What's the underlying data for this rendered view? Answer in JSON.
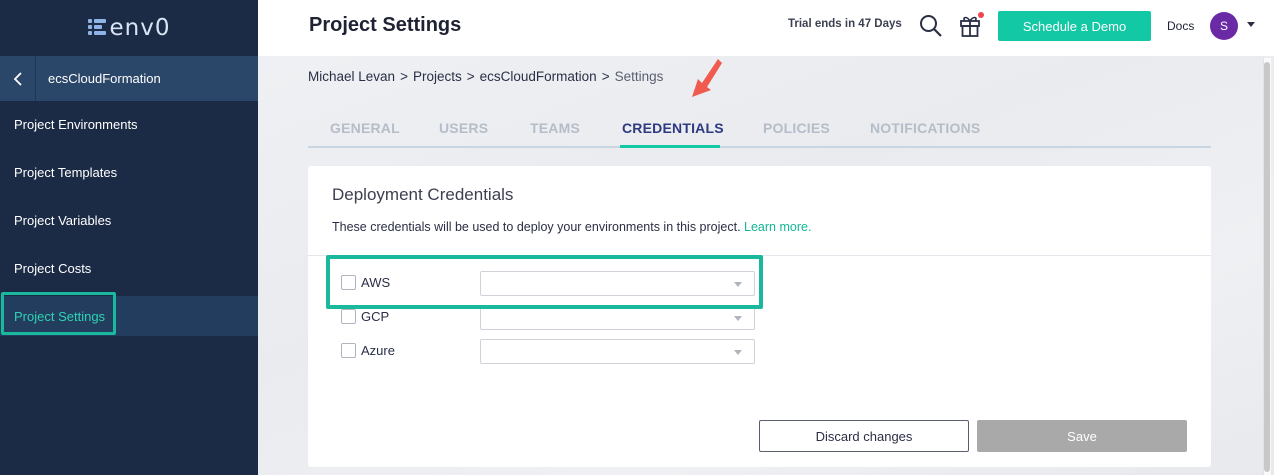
{
  "app": {
    "logo_text": "env0"
  },
  "sidebar": {
    "back_label": "<",
    "project_name": "ecsCloudFormation",
    "items": [
      {
        "label": "Project Environments"
      },
      {
        "label": "Project Templates"
      },
      {
        "label": "Project Variables"
      },
      {
        "label": "Project Costs"
      },
      {
        "label": "Project Settings",
        "active": true
      }
    ]
  },
  "header": {
    "title": "Project Settings",
    "trial_text": "Trial ends in 47 Days",
    "demo_button": "Schedule a Demo",
    "docs_label": "Docs",
    "avatar_initial": "S"
  },
  "breadcrumb": [
    "Michael Levan",
    "Projects",
    "ecsCloudFormation",
    "Settings"
  ],
  "breadcrumb_separator": ">",
  "tabs": [
    {
      "label": "GENERAL"
    },
    {
      "label": "USERS"
    },
    {
      "label": "TEAMS"
    },
    {
      "label": "CREDENTIALS",
      "active": true
    },
    {
      "label": "POLICIES"
    },
    {
      "label": "NOTIFICATIONS"
    }
  ],
  "credentials": {
    "title": "Deployment Credentials",
    "description": "These credentials will be used to deploy your environments in this project.",
    "learn_more": "Learn more.",
    "providers": [
      {
        "label": "AWS",
        "checked": false,
        "selected": ""
      },
      {
        "label": "GCP",
        "checked": false,
        "selected": ""
      },
      {
        "label": "Azure",
        "checked": false,
        "selected": ""
      }
    ],
    "discard_label": "Discard changes",
    "save_label": "Save"
  },
  "colors": {
    "accent": "#13c8a4",
    "sidebar_bg": "#1b2a45",
    "active_tab": "#2d3a82",
    "highlight": "#1ab89c",
    "annotation_arrow": "#f05a4f"
  }
}
